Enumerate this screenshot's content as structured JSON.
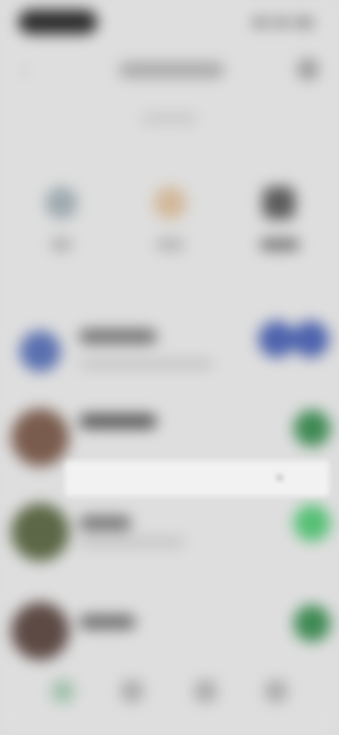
{
  "colors": {
    "background": "#dedede",
    "accent_blue": "#4d63ad",
    "accent_green": "#3f8a54",
    "accent_green_light": "#56c075"
  },
  "status_bar": {
    "time": "",
    "icons": [
      "signal-icon",
      "wifi-icon",
      "battery-icon"
    ]
  },
  "nav": {
    "back_icon": "chevron-left-icon",
    "title": "",
    "action_icon": "more-icon"
  },
  "subtitle": "",
  "actions": [
    {
      "icon": "call-icon",
      "label": ""
    },
    {
      "icon": "video-icon",
      "label": ""
    },
    {
      "icon": "grid-icon",
      "label": ""
    }
  ],
  "list": [
    {
      "name": "",
      "meta": "",
      "avatar_icon": "group-icon",
      "action_icons": [
        "call-icon",
        "video-icon"
      ]
    },
    {
      "name": "",
      "meta": "",
      "action_icon": "call-icon"
    },
    {
      "name": "",
      "meta": "",
      "action_icon": "call-icon"
    },
    {
      "name": "",
      "meta": "",
      "action_icon": "call-icon"
    }
  ],
  "toast": {
    "text": "",
    "close_icon": "close-icon"
  },
  "tab_bar": [
    {
      "icon": "chat-icon"
    },
    {
      "icon": "phone-icon"
    },
    {
      "icon": "contacts-icon"
    },
    {
      "icon": "settings-icon"
    }
  ]
}
